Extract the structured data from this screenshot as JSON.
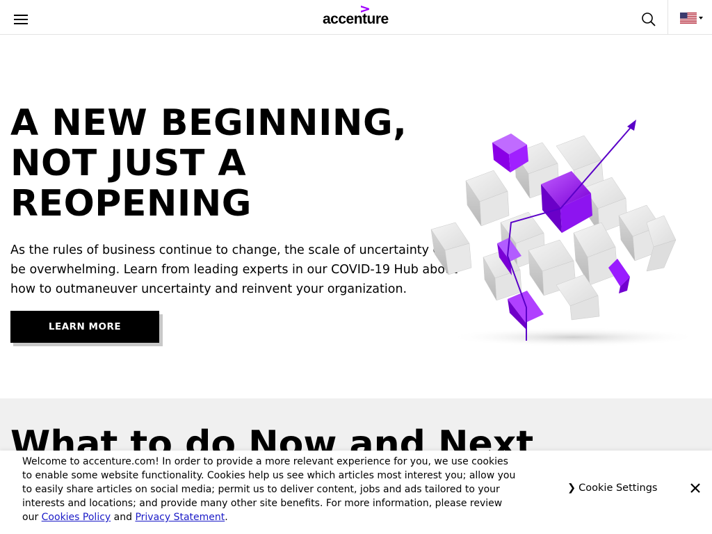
{
  "header": {
    "logo_text": "accenture",
    "brand_color": "#a100ff",
    "menu_icon": "hamburger-menu-icon",
    "search_icon": "search-icon",
    "flag_icon": "us-flag-icon"
  },
  "hero": {
    "title_lines": [
      "A NEW BEGINNING,",
      "NOT JUST A",
      "REOPENING"
    ],
    "body": "As the rules of business continue to change, the scale of uncertainty can be overwhelming. Learn from leading experts in our COVID-19 Hub about how to outmaneuver uncertainty and reinvent your organization.",
    "cta_label": "LEARN MORE"
  },
  "section": {
    "heading": "What to do Now and Next"
  },
  "cookie_banner": {
    "text_before": "Welcome to accenture.com! In order to provide a more relevant experience for you, we use cookies to enable some website functionality. Cookies help us see which articles most interest you; allow you to easily share articles on social media; permit us to deliver content, jobs and ads tailored to your interests and locations; and provide many other site benefits. For more information, please review our ",
    "link_cookies": "Cookies Policy",
    "text_and": " and ",
    "link_privacy": "Privacy Statement",
    "text_end": ".",
    "settings_chevron": "❯",
    "settings_label": "Cookie Settings",
    "close_icon": "close-icon",
    "link_color": "#1a1ac7"
  }
}
